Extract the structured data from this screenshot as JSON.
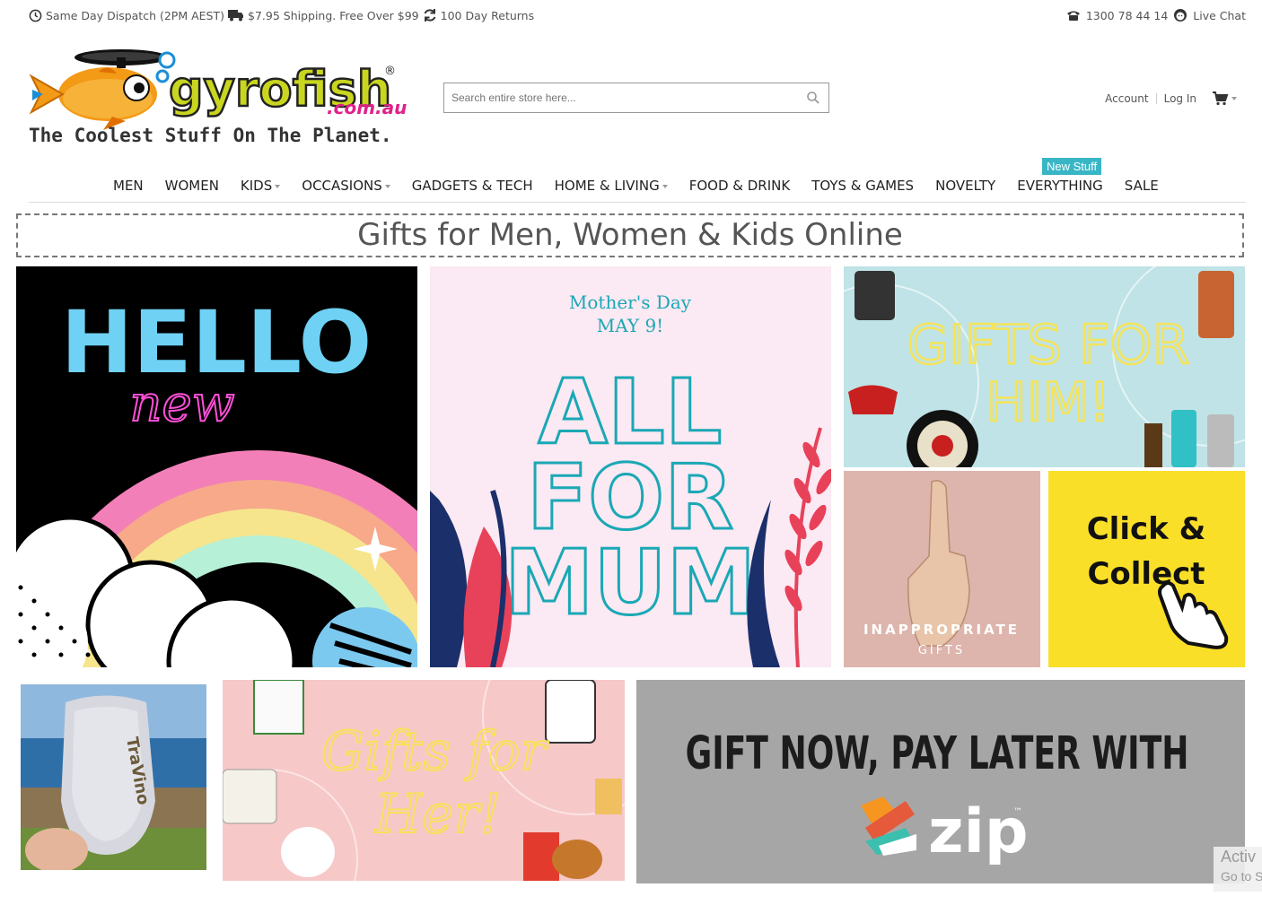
{
  "topbar": {
    "dispatch": "Same Day Dispatch (2PM AEST)",
    "shipping": "$7.95 Shipping. Free Over $99",
    "returns": "100 Day Returns",
    "phone": "1300 78 44 14",
    "live_chat": "Live Chat"
  },
  "logo": {
    "brand": "gyrofish",
    "domain": ".com.au",
    "reg": "®",
    "tagline": "The Coolest Stuff On The Planet."
  },
  "search": {
    "placeholder": "Search entire store here..."
  },
  "account": {
    "account_label": "Account",
    "login_label": "Log In"
  },
  "nav": {
    "items": [
      {
        "label": "MEN"
      },
      {
        "label": "WOMEN"
      },
      {
        "label": "KIDS"
      },
      {
        "label": "OCCASIONS"
      },
      {
        "label": "GADGETS & TECH"
      },
      {
        "label": "HOME & LIVING"
      },
      {
        "label": "FOOD & DRINK"
      },
      {
        "label": "TOYS & GAMES"
      },
      {
        "label": "NOVELTY"
      },
      {
        "label": "EVERYTHING"
      },
      {
        "label": "SALE"
      }
    ],
    "new_badge": "New Stuff"
  },
  "headline": "Gifts for Men, Women & Kids Online",
  "tiles": {
    "hello": {
      "line1": "HELLO",
      "line2": "new"
    },
    "mum": {
      "line1": "Mother's Day",
      "line2": "MAY 9!",
      "big1": "ALL",
      "big2": "FOR",
      "big3": "MUM"
    },
    "him": {
      "line1": "GIFTS FOR",
      "line2": "HIM!"
    },
    "inappropriate": {
      "line1": "INAPPROPRIATE",
      "line2": "GIFTS"
    },
    "click": {
      "line1": "Click &",
      "line2": "Collect"
    },
    "travino": {
      "label": "TraVino"
    },
    "her": {
      "line1": "Gifts for",
      "line2": "Her!"
    },
    "zip": {
      "line1": "GIFT NOW, PAY LATER WITH",
      "logo": "zip",
      "tm": "™"
    }
  },
  "watermark": {
    "line1": "Activ",
    "line2": "Go to S"
  },
  "colors": {
    "accent_badge": "#39b6c6",
    "logo_yellow": "#c9d61f",
    "logo_pink": "#e0218a",
    "click_yellow": "#fadf29",
    "zip_gray": "#a6a6a6"
  }
}
